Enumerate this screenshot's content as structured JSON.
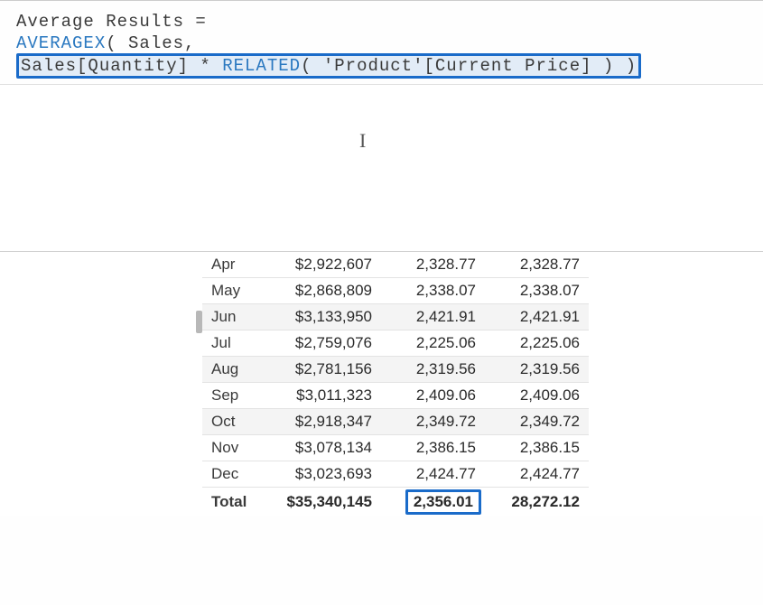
{
  "formula": {
    "line1": "Average Results =",
    "line2_fn1": "AVERAGEX",
    "line2_paren_open": "( ",
    "line2_table": "Sales",
    "line2_comma": ", ",
    "line2_hl_col1": "Sales[Quantity] * ",
    "line2_hl_fn": "RELATED",
    "line2_hl_rest": "( 'Product'[Current Price] ) ",
    "line2_close": ")"
  },
  "caret": "I",
  "table": {
    "rows": [
      {
        "month": "Apr",
        "v1": "$2,922,607",
        "v2": "2,328.77",
        "v3": "2,328.77",
        "shaded": false
      },
      {
        "month": "May",
        "v1": "$2,868,809",
        "v2": "2,338.07",
        "v3": "2,338.07",
        "shaded": false
      },
      {
        "month": "Jun",
        "v1": "$3,133,950",
        "v2": "2,421.91",
        "v3": "2,421.91",
        "shaded": true
      },
      {
        "month": "Jul",
        "v1": "$2,759,076",
        "v2": "2,225.06",
        "v3": "2,225.06",
        "shaded": false
      },
      {
        "month": "Aug",
        "v1": "$2,781,156",
        "v2": "2,319.56",
        "v3": "2,319.56",
        "shaded": true
      },
      {
        "month": "Sep",
        "v1": "$3,011,323",
        "v2": "2,409.06",
        "v3": "2,409.06",
        "shaded": false
      },
      {
        "month": "Oct",
        "v1": "$2,918,347",
        "v2": "2,349.72",
        "v3": "2,349.72",
        "shaded": true
      },
      {
        "month": "Nov",
        "v1": "$3,078,134",
        "v2": "2,386.15",
        "v3": "2,386.15",
        "shaded": false
      },
      {
        "month": "Dec",
        "v1": "$3,023,693",
        "v2": "2,424.77",
        "v3": "2,424.77",
        "shaded": false
      }
    ],
    "total": {
      "label": "Total",
      "v1": "$35,340,145",
      "v2": "2,356.01",
      "v3": "28,272.12"
    }
  }
}
